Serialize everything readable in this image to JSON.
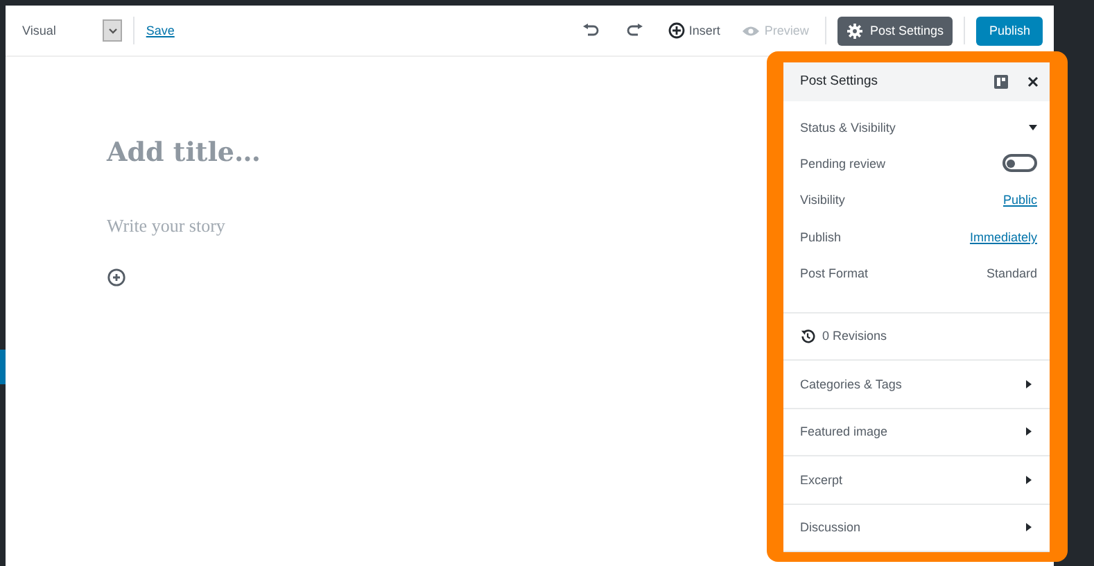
{
  "toolbar": {
    "mode": "Visual",
    "save": "Save",
    "insert": "Insert",
    "preview": {
      "label": "Preview",
      "disabled": true
    },
    "post_settings": {
      "label": "Post Settings",
      "selected": true
    },
    "publish": "Publish"
  },
  "editor": {
    "title_placeholder": "Add title…",
    "body_placeholder": "Write your story"
  },
  "sidebar": {
    "title": "Post Settings",
    "status_section": {
      "title": "Status & Visibility",
      "expanded": true,
      "rows": [
        {
          "kind": "toggle",
          "label": "Pending review",
          "on": false
        },
        {
          "kind": "link",
          "label": "Visibility",
          "value": "Public"
        },
        {
          "kind": "link",
          "label": "Publish",
          "value": "Immediately"
        },
        {
          "kind": "text",
          "label": "Post Format",
          "value": "Standard"
        }
      ]
    },
    "revisions": "0 Revisions",
    "panels": [
      {
        "title": "Categories & Tags",
        "expanded": false
      },
      {
        "title": "Featured image",
        "expanded": false
      },
      {
        "title": "Excerpt",
        "expanded": false
      },
      {
        "title": "Discussion",
        "expanded": false
      }
    ]
  }
}
